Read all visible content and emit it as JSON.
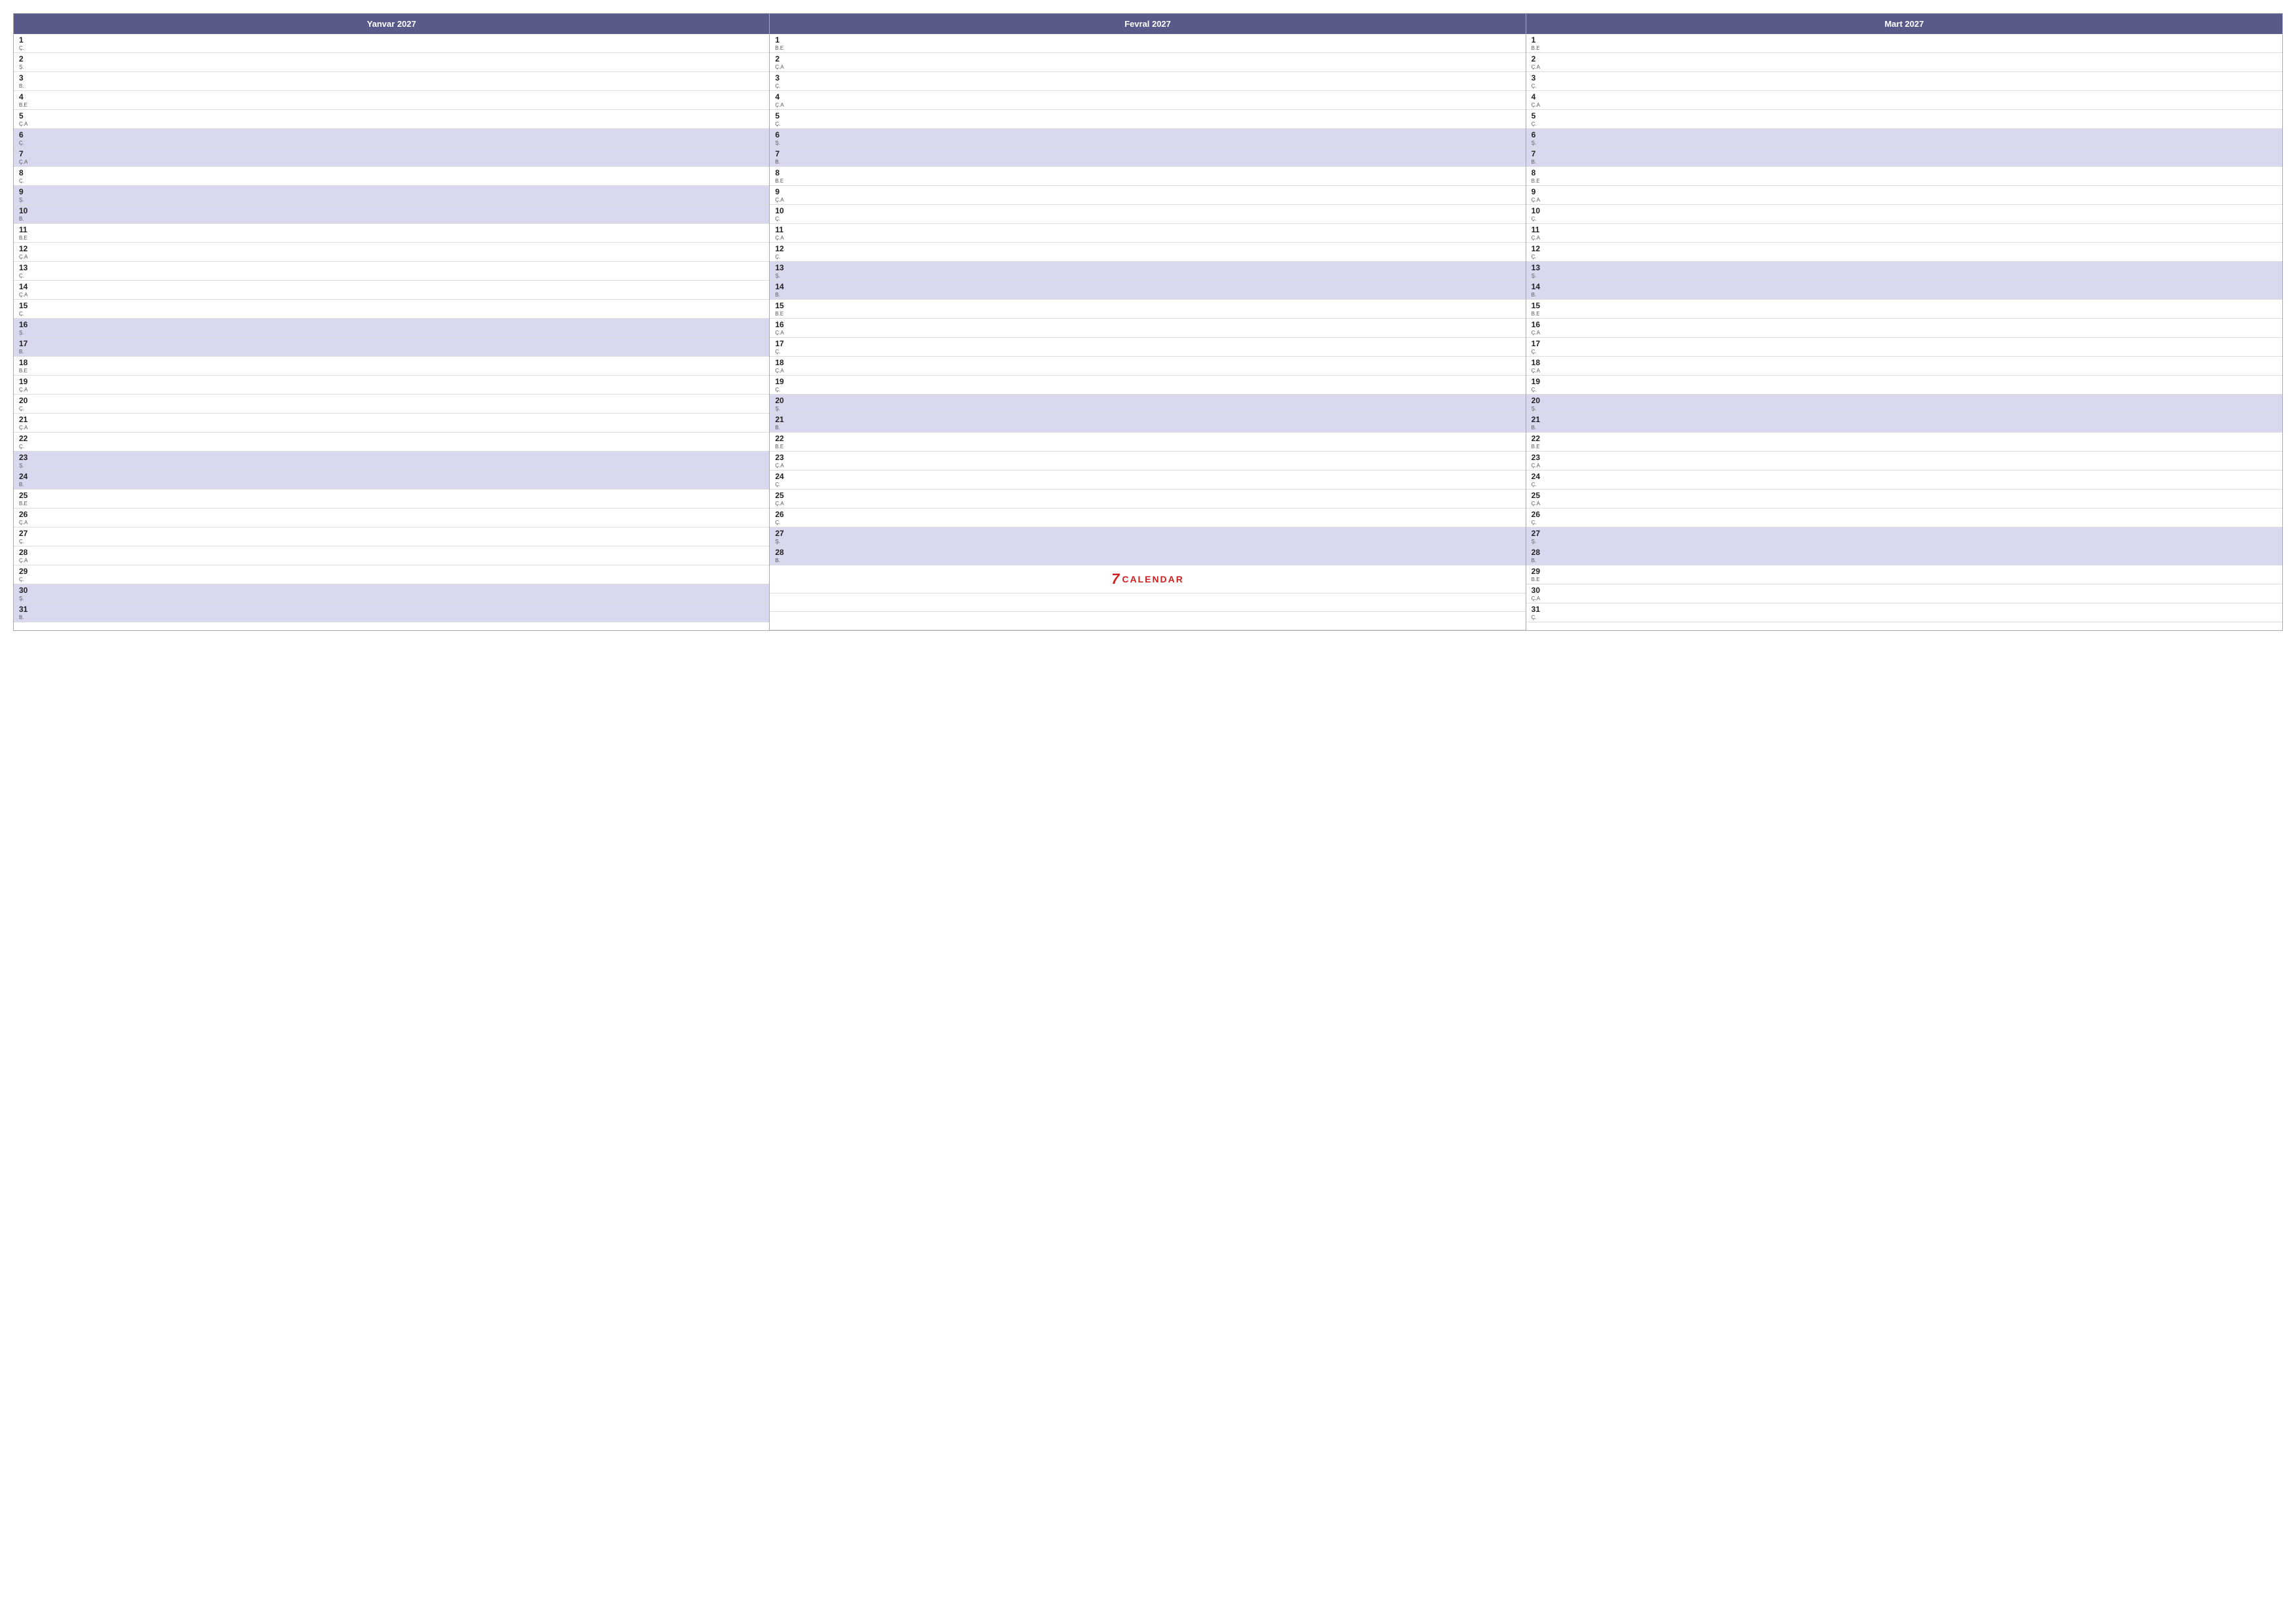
{
  "months": [
    {
      "name": "Yanvar 2027",
      "days": [
        {
          "num": "1",
          "label": "Ç.",
          "highlight": false
        },
        {
          "num": "2",
          "label": "Ş.",
          "highlight": false
        },
        {
          "num": "3",
          "label": "B.",
          "highlight": false
        },
        {
          "num": "4",
          "label": "B.E",
          "highlight": false
        },
        {
          "num": "5",
          "label": "Ç.A",
          "highlight": false
        },
        {
          "num": "6",
          "label": "Ç.",
          "highlight": true
        },
        {
          "num": "7",
          "label": "Ç.A",
          "highlight": true
        },
        {
          "num": "8",
          "label": "Ç.",
          "highlight": false
        },
        {
          "num": "9",
          "label": "Ş.",
          "highlight": true
        },
        {
          "num": "10",
          "label": "B.",
          "highlight": true
        },
        {
          "num": "11",
          "label": "B.E",
          "highlight": false
        },
        {
          "num": "12",
          "label": "Ç.A",
          "highlight": false
        },
        {
          "num": "13",
          "label": "Ç.",
          "highlight": false
        },
        {
          "num": "14",
          "label": "Ç.A",
          "highlight": false
        },
        {
          "num": "15",
          "label": "Ç.",
          "highlight": false
        },
        {
          "num": "16",
          "label": "Ş.",
          "highlight": true
        },
        {
          "num": "17",
          "label": "B.",
          "highlight": true
        },
        {
          "num": "18",
          "label": "B.E",
          "highlight": false
        },
        {
          "num": "19",
          "label": "Ç.A",
          "highlight": false
        },
        {
          "num": "20",
          "label": "Ç.",
          "highlight": false
        },
        {
          "num": "21",
          "label": "Ç.A",
          "highlight": false
        },
        {
          "num": "22",
          "label": "Ç.",
          "highlight": false
        },
        {
          "num": "23",
          "label": "Ş.",
          "highlight": true
        },
        {
          "num": "24",
          "label": "B.",
          "highlight": true
        },
        {
          "num": "25",
          "label": "B.E",
          "highlight": false
        },
        {
          "num": "26",
          "label": "Ç.A",
          "highlight": false
        },
        {
          "num": "27",
          "label": "Ç.",
          "highlight": false
        },
        {
          "num": "28",
          "label": "Ç.A",
          "highlight": false
        },
        {
          "num": "29",
          "label": "Ç.",
          "highlight": false
        },
        {
          "num": "30",
          "label": "Ş.",
          "highlight": true
        },
        {
          "num": "31",
          "label": "B.",
          "highlight": true
        }
      ]
    },
    {
      "name": "Fevral 2027",
      "days": [
        {
          "num": "1",
          "label": "B.E",
          "highlight": false
        },
        {
          "num": "2",
          "label": "Ç.A",
          "highlight": false
        },
        {
          "num": "3",
          "label": "Ç.",
          "highlight": false
        },
        {
          "num": "4",
          "label": "Ç.A",
          "highlight": false
        },
        {
          "num": "5",
          "label": "Ç.",
          "highlight": false
        },
        {
          "num": "6",
          "label": "Ş.",
          "highlight": true
        },
        {
          "num": "7",
          "label": "B.",
          "highlight": true
        },
        {
          "num": "8",
          "label": "B.E",
          "highlight": false
        },
        {
          "num": "9",
          "label": "Ç.A",
          "highlight": false
        },
        {
          "num": "10",
          "label": "Ç.",
          "highlight": false
        },
        {
          "num": "11",
          "label": "Ç.A",
          "highlight": false
        },
        {
          "num": "12",
          "label": "Ç.",
          "highlight": false
        },
        {
          "num": "13",
          "label": "Ş.",
          "highlight": true
        },
        {
          "num": "14",
          "label": "B.",
          "highlight": true
        },
        {
          "num": "15",
          "label": "B.E",
          "highlight": false
        },
        {
          "num": "16",
          "label": "Ç.A",
          "highlight": false
        },
        {
          "num": "17",
          "label": "Ç.",
          "highlight": false
        },
        {
          "num": "18",
          "label": "Ç.A",
          "highlight": false
        },
        {
          "num": "19",
          "label": "Ç.",
          "highlight": false
        },
        {
          "num": "20",
          "label": "Ş.",
          "highlight": true
        },
        {
          "num": "21",
          "label": "B.",
          "highlight": true
        },
        {
          "num": "22",
          "label": "B.E",
          "highlight": false
        },
        {
          "num": "23",
          "label": "Ç.A",
          "highlight": false
        },
        {
          "num": "24",
          "label": "Ç.",
          "highlight": false
        },
        {
          "num": "25",
          "label": "Ç.A",
          "highlight": false
        },
        {
          "num": "26",
          "label": "Ç.",
          "highlight": false
        },
        {
          "num": "27",
          "label": "Ş.",
          "highlight": true
        },
        {
          "num": "28",
          "label": "B.",
          "highlight": true
        }
      ],
      "extra_rows": 3,
      "logo": true
    },
    {
      "name": "Mart 2027",
      "days": [
        {
          "num": "1",
          "label": "B.E",
          "highlight": false
        },
        {
          "num": "2",
          "label": "Ç.A",
          "highlight": false
        },
        {
          "num": "3",
          "label": "Ç.",
          "highlight": false
        },
        {
          "num": "4",
          "label": "Ç.A",
          "highlight": false
        },
        {
          "num": "5",
          "label": "Ç.",
          "highlight": false
        },
        {
          "num": "6",
          "label": "Ş.",
          "highlight": true
        },
        {
          "num": "7",
          "label": "B.",
          "highlight": true
        },
        {
          "num": "8",
          "label": "B.E",
          "highlight": false
        },
        {
          "num": "9",
          "label": "Ç.A",
          "highlight": false
        },
        {
          "num": "10",
          "label": "Ç.",
          "highlight": false
        },
        {
          "num": "11",
          "label": "Ç.A",
          "highlight": false
        },
        {
          "num": "12",
          "label": "Ç.",
          "highlight": false
        },
        {
          "num": "13",
          "label": "Ş.",
          "highlight": true
        },
        {
          "num": "14",
          "label": "B.",
          "highlight": true
        },
        {
          "num": "15",
          "label": "B.E",
          "highlight": false
        },
        {
          "num": "16",
          "label": "Ç.A",
          "highlight": false
        },
        {
          "num": "17",
          "label": "Ç.",
          "highlight": false
        },
        {
          "num": "18",
          "label": "Ç.A",
          "highlight": false
        },
        {
          "num": "19",
          "label": "Ç.",
          "highlight": false
        },
        {
          "num": "20",
          "label": "Ş.",
          "highlight": true
        },
        {
          "num": "21",
          "label": "B.",
          "highlight": true
        },
        {
          "num": "22",
          "label": "B.E",
          "highlight": false
        },
        {
          "num": "23",
          "label": "Ç.A",
          "highlight": false
        },
        {
          "num": "24",
          "label": "Ç.",
          "highlight": false
        },
        {
          "num": "25",
          "label": "Ç.A",
          "highlight": false
        },
        {
          "num": "26",
          "label": "Ç.",
          "highlight": false
        },
        {
          "num": "27",
          "label": "Ş.",
          "highlight": true
        },
        {
          "num": "28",
          "label": "B.",
          "highlight": true
        },
        {
          "num": "29",
          "label": "B.E",
          "highlight": false
        },
        {
          "num": "30",
          "label": "Ç.A",
          "highlight": false
        },
        {
          "num": "31",
          "label": "Ç.",
          "highlight": false
        }
      ]
    }
  ],
  "logo": {
    "number": "7",
    "text": "CALENDAR"
  }
}
